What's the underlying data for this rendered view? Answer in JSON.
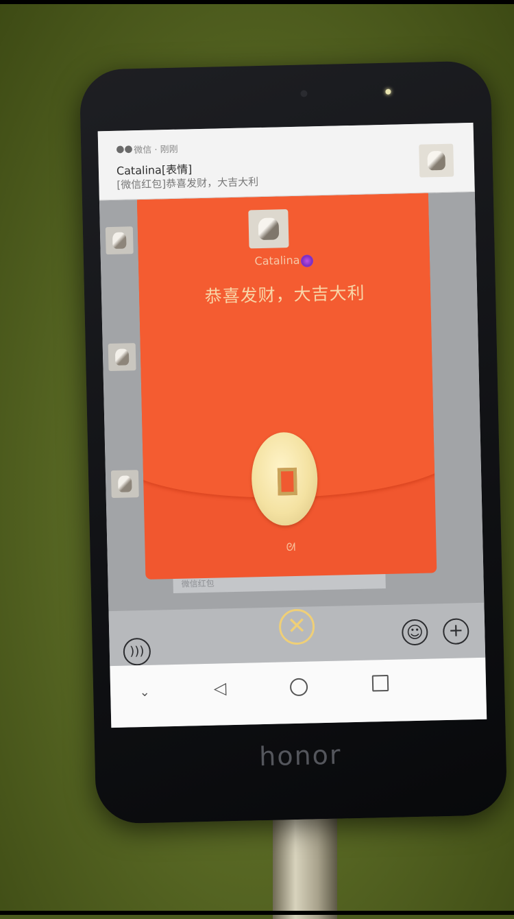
{
  "notification": {
    "app": "微信 · 刚刚",
    "title": "Catalina[表情]",
    "body": "[微信红包]恭喜发财，大吉大利",
    "icon": "wechat-icon"
  },
  "red_packet": {
    "sender": "Catalina",
    "blessing": "恭喜发财，大吉大利",
    "open_icon": "coin-icon",
    "accent_color": "#f1572f",
    "coin_color": "#f4e2a2"
  },
  "chat": {
    "bubble_label": "微信红包"
  },
  "input_bar": {
    "voice_icon": "voice-icon",
    "emoji_icon": "emoji-icon",
    "plus_icon": "plus-icon"
  },
  "close": {
    "symbol": "✕"
  },
  "nav": {
    "hide_icon": "chevron-down-icon",
    "back_icon": "back-icon",
    "home_icon": "home-icon",
    "recent_icon": "recent-apps-icon"
  },
  "device": {
    "brand": "honor"
  }
}
